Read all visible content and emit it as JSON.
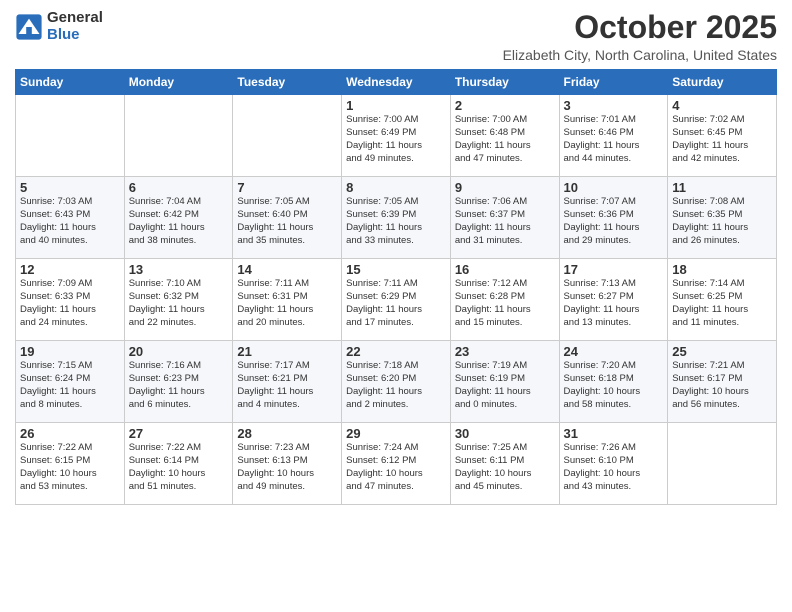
{
  "logo": {
    "general": "General",
    "blue": "Blue"
  },
  "title": "October 2025",
  "location": "Elizabeth City, North Carolina, United States",
  "weekdays": [
    "Sunday",
    "Monday",
    "Tuesday",
    "Wednesday",
    "Thursday",
    "Friday",
    "Saturday"
  ],
  "weeks": [
    [
      {
        "day": "",
        "info": ""
      },
      {
        "day": "",
        "info": ""
      },
      {
        "day": "",
        "info": ""
      },
      {
        "day": "1",
        "info": "Sunrise: 7:00 AM\nSunset: 6:49 PM\nDaylight: 11 hours\nand 49 minutes."
      },
      {
        "day": "2",
        "info": "Sunrise: 7:00 AM\nSunset: 6:48 PM\nDaylight: 11 hours\nand 47 minutes."
      },
      {
        "day": "3",
        "info": "Sunrise: 7:01 AM\nSunset: 6:46 PM\nDaylight: 11 hours\nand 44 minutes."
      },
      {
        "day": "4",
        "info": "Sunrise: 7:02 AM\nSunset: 6:45 PM\nDaylight: 11 hours\nand 42 minutes."
      }
    ],
    [
      {
        "day": "5",
        "info": "Sunrise: 7:03 AM\nSunset: 6:43 PM\nDaylight: 11 hours\nand 40 minutes."
      },
      {
        "day": "6",
        "info": "Sunrise: 7:04 AM\nSunset: 6:42 PM\nDaylight: 11 hours\nand 38 minutes."
      },
      {
        "day": "7",
        "info": "Sunrise: 7:05 AM\nSunset: 6:40 PM\nDaylight: 11 hours\nand 35 minutes."
      },
      {
        "day": "8",
        "info": "Sunrise: 7:05 AM\nSunset: 6:39 PM\nDaylight: 11 hours\nand 33 minutes."
      },
      {
        "day": "9",
        "info": "Sunrise: 7:06 AM\nSunset: 6:37 PM\nDaylight: 11 hours\nand 31 minutes."
      },
      {
        "day": "10",
        "info": "Sunrise: 7:07 AM\nSunset: 6:36 PM\nDaylight: 11 hours\nand 29 minutes."
      },
      {
        "day": "11",
        "info": "Sunrise: 7:08 AM\nSunset: 6:35 PM\nDaylight: 11 hours\nand 26 minutes."
      }
    ],
    [
      {
        "day": "12",
        "info": "Sunrise: 7:09 AM\nSunset: 6:33 PM\nDaylight: 11 hours\nand 24 minutes."
      },
      {
        "day": "13",
        "info": "Sunrise: 7:10 AM\nSunset: 6:32 PM\nDaylight: 11 hours\nand 22 minutes."
      },
      {
        "day": "14",
        "info": "Sunrise: 7:11 AM\nSunset: 6:31 PM\nDaylight: 11 hours\nand 20 minutes."
      },
      {
        "day": "15",
        "info": "Sunrise: 7:11 AM\nSunset: 6:29 PM\nDaylight: 11 hours\nand 17 minutes."
      },
      {
        "day": "16",
        "info": "Sunrise: 7:12 AM\nSunset: 6:28 PM\nDaylight: 11 hours\nand 15 minutes."
      },
      {
        "day": "17",
        "info": "Sunrise: 7:13 AM\nSunset: 6:27 PM\nDaylight: 11 hours\nand 13 minutes."
      },
      {
        "day": "18",
        "info": "Sunrise: 7:14 AM\nSunset: 6:25 PM\nDaylight: 11 hours\nand 11 minutes."
      }
    ],
    [
      {
        "day": "19",
        "info": "Sunrise: 7:15 AM\nSunset: 6:24 PM\nDaylight: 11 hours\nand 8 minutes."
      },
      {
        "day": "20",
        "info": "Sunrise: 7:16 AM\nSunset: 6:23 PM\nDaylight: 11 hours\nand 6 minutes."
      },
      {
        "day": "21",
        "info": "Sunrise: 7:17 AM\nSunset: 6:21 PM\nDaylight: 11 hours\nand 4 minutes."
      },
      {
        "day": "22",
        "info": "Sunrise: 7:18 AM\nSunset: 6:20 PM\nDaylight: 11 hours\nand 2 minutes."
      },
      {
        "day": "23",
        "info": "Sunrise: 7:19 AM\nSunset: 6:19 PM\nDaylight: 11 hours\nand 0 minutes."
      },
      {
        "day": "24",
        "info": "Sunrise: 7:20 AM\nSunset: 6:18 PM\nDaylight: 10 hours\nand 58 minutes."
      },
      {
        "day": "25",
        "info": "Sunrise: 7:21 AM\nSunset: 6:17 PM\nDaylight: 10 hours\nand 56 minutes."
      }
    ],
    [
      {
        "day": "26",
        "info": "Sunrise: 7:22 AM\nSunset: 6:15 PM\nDaylight: 10 hours\nand 53 minutes."
      },
      {
        "day": "27",
        "info": "Sunrise: 7:22 AM\nSunset: 6:14 PM\nDaylight: 10 hours\nand 51 minutes."
      },
      {
        "day": "28",
        "info": "Sunrise: 7:23 AM\nSunset: 6:13 PM\nDaylight: 10 hours\nand 49 minutes."
      },
      {
        "day": "29",
        "info": "Sunrise: 7:24 AM\nSunset: 6:12 PM\nDaylight: 10 hours\nand 47 minutes."
      },
      {
        "day": "30",
        "info": "Sunrise: 7:25 AM\nSunset: 6:11 PM\nDaylight: 10 hours\nand 45 minutes."
      },
      {
        "day": "31",
        "info": "Sunrise: 7:26 AM\nSunset: 6:10 PM\nDaylight: 10 hours\nand 43 minutes."
      },
      {
        "day": "",
        "info": ""
      }
    ]
  ]
}
